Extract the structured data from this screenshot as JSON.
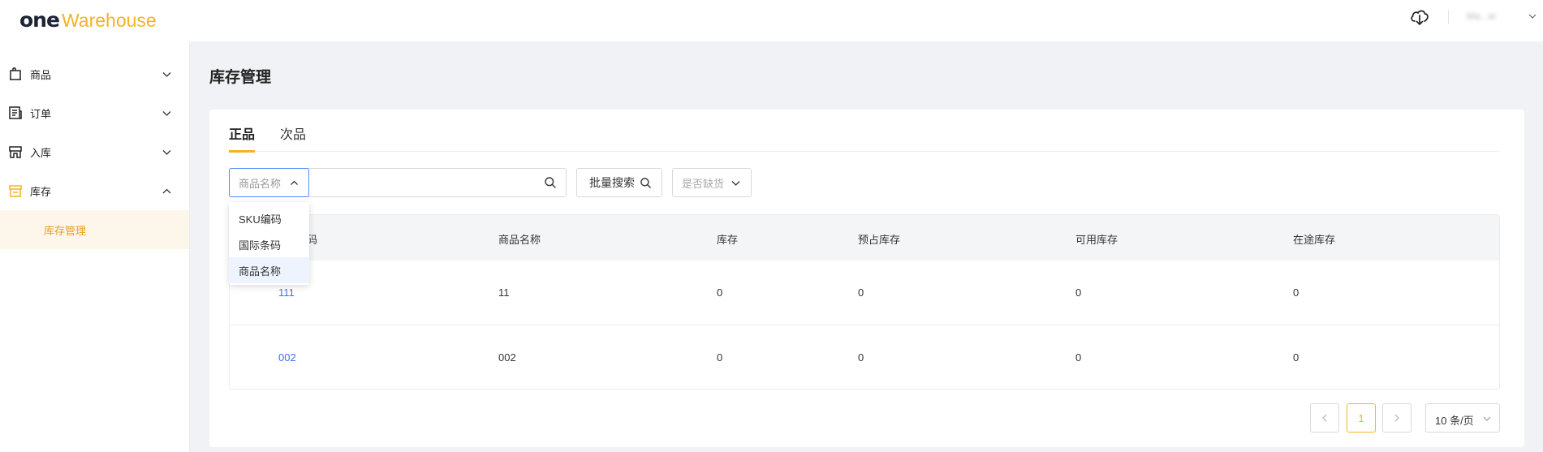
{
  "header": {
    "logo_one": "one",
    "logo_warehouse": "Warehouse",
    "user_name": "Ma...ie",
    "icons": {
      "download": "cloud-download-icon",
      "user_menu": "chevron-down-icon"
    }
  },
  "sidebar": {
    "items": [
      {
        "label": "商品",
        "icon": "product-bag-icon",
        "expanded": false
      },
      {
        "label": "订单",
        "icon": "order-receipt-icon",
        "expanded": false
      },
      {
        "label": "入库",
        "icon": "inbound-store-icon",
        "expanded": false
      },
      {
        "label": "库存",
        "icon": "inventory-store-icon",
        "expanded": true
      }
    ],
    "sub_items": [
      {
        "label": "库存管理",
        "active": true
      }
    ]
  },
  "page": {
    "title": "库存管理",
    "tabs": [
      {
        "label": "正品",
        "active": true
      },
      {
        "label": "次品",
        "active": false
      }
    ]
  },
  "filters": {
    "field_select": "商品名称",
    "search_value": "",
    "batch_search": "批量搜索",
    "stock_status": "是否缺货",
    "field_options": [
      "SKU编码",
      "国际条码",
      "商品名称"
    ],
    "selected_option": "商品名称"
  },
  "table": {
    "columns": [
      "SKU编码",
      "商品名称",
      "库存",
      "预占库存",
      "可用库存",
      "在途库存"
    ],
    "visible_first_header": "码",
    "rows": [
      [
        "111",
        "11",
        "0",
        "0",
        "0",
        "0"
      ],
      [
        "002",
        "002",
        "0",
        "0",
        "0",
        "0"
      ]
    ]
  },
  "pagination": {
    "current_page": "1",
    "page_size": "10 条/页"
  },
  "colors": {
    "accent": "#f5b324",
    "link": "#3d73e5",
    "focus": "#4d8cf5"
  }
}
